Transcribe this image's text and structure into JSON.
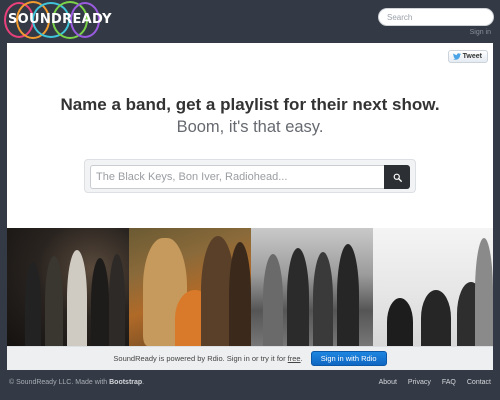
{
  "header": {
    "logo_text": "SOUNDREADY",
    "search_placeholder": "Search",
    "sign_in": "Sign in"
  },
  "hero": {
    "tweet_label": "Tweet",
    "headline": "Name a band, get a playlist for their next show.",
    "subline": "Boom, it's that easy.",
    "search_placeholder": "The Black Keys, Bon Iver, Radiohead..."
  },
  "photos": [
    {
      "name": "band-photo-1"
    },
    {
      "name": "band-photo-2"
    },
    {
      "name": "band-photo-3"
    },
    {
      "name": "band-photo-4"
    }
  ],
  "rdio_bar": {
    "text_before": "SoundReady is powered by Rdio. Sign in or try it for ",
    "free_link": "free",
    "text_after": ".",
    "button_label": "Sign in with Rdio"
  },
  "footer": {
    "copyright": "© SoundReady LLC. Made with ",
    "made_with": "Bootstrap",
    "copyright_end": ".",
    "nav": [
      "About",
      "Privacy",
      "FAQ",
      "Contact"
    ]
  },
  "colors": {
    "page_bg": "#343a45",
    "rdio_button": "#1574d4",
    "search_button": "#2c2f33"
  },
  "icons": {
    "tweet": "bird-icon",
    "search": "magnifier-icon"
  }
}
